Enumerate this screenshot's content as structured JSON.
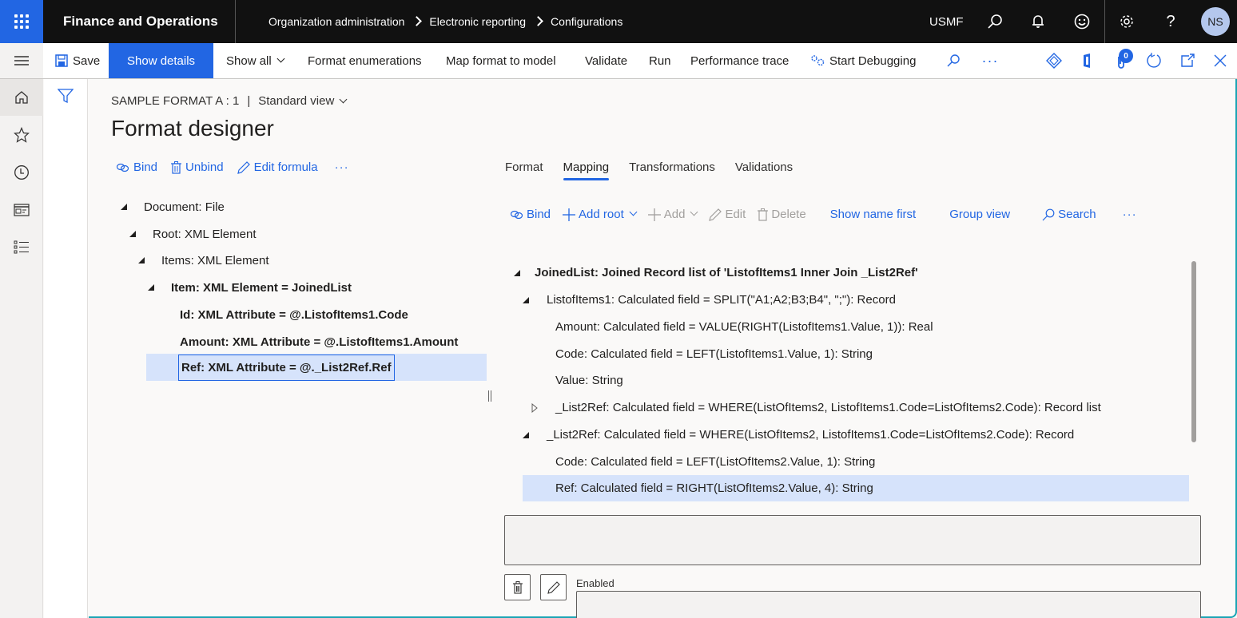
{
  "topbar": {
    "app_title": "Finance and Operations",
    "breadcrumb": [
      "Organization administration",
      "Electronic reporting",
      "Configurations"
    ],
    "company": "USMF",
    "avatar_initials": "NS",
    "icons": [
      "search-icon",
      "bell-icon",
      "smiley-icon",
      "settings-icon",
      "help-icon"
    ]
  },
  "actionbar": {
    "save": "Save",
    "show_details": "Show details",
    "show_all": "Show all",
    "format_enumerations": "Format enumerations",
    "map_format_to_model": "Map format to model",
    "validate": "Validate",
    "run": "Run",
    "performance_trace": "Performance trace",
    "start_debugging": "Start Debugging",
    "attachments_count": "0",
    "colors": {
      "accent": "#2266e3",
      "topbar": "#111111"
    }
  },
  "page": {
    "context": "SAMPLE FORMAT A : 1",
    "separator": "|",
    "view": "Standard view",
    "title": "Format designer"
  },
  "format_toolbar": {
    "bind": "Bind",
    "unbind": "Unbind",
    "edit_formula": "Edit formula",
    "more": "···"
  },
  "format_tree": [
    {
      "label": "Document: File",
      "expanded": true,
      "bold": false
    },
    {
      "label": "Root: XML Element",
      "expanded": true,
      "bold": false
    },
    {
      "label": "Items: XML Element",
      "expanded": true,
      "bold": false
    },
    {
      "label": "Item: XML Element = JoinedList",
      "expanded": true,
      "bold": true
    },
    {
      "label": "Id: XML Attribute = @.ListofItems1.Code",
      "bold": true
    },
    {
      "label": "Amount: XML Attribute = @.ListofItems1.Amount",
      "bold": true
    },
    {
      "label": "Ref: XML Attribute = @._List2Ref.Ref",
      "bold": true,
      "selected": true
    }
  ],
  "tabs": [
    {
      "label": "Format",
      "active": false
    },
    {
      "label": "Mapping",
      "active": true
    },
    {
      "label": "Transformations",
      "active": false
    },
    {
      "label": "Validations",
      "active": false
    }
  ],
  "mapping_toolbar": {
    "bind": "Bind",
    "add_root": "Add root",
    "add": "Add",
    "edit": "Edit",
    "delete": "Delete",
    "show_name_first": "Show name first",
    "group_view": "Group view",
    "search": "Search",
    "more": "···"
  },
  "mapping_tree": [
    {
      "label": "JoinedList: Joined Record list of 'ListofItems1 Inner Join _List2Ref'",
      "expanded": true,
      "bold": true
    },
    {
      "label": "ListofItems1: Calculated field = SPLIT(\"A1;A2;B3;B4\", \";\"): Record",
      "expanded": true
    },
    {
      "label": "Amount: Calculated field = VALUE(RIGHT(ListofItems1.Value, 1)): Real"
    },
    {
      "label": "Code: Calculated field = LEFT(ListofItems1.Value, 1): String"
    },
    {
      "label": "Value: String"
    },
    {
      "label": "_List2Ref: Calculated field = WHERE(ListOfItems2, ListofItems1.Code=ListOfItems2.Code): Record list",
      "expanded": false
    },
    {
      "label": "_List2Ref: Calculated field = WHERE(ListOfItems2, ListofItems1.Code=ListOfItems2.Code): Record",
      "expanded": true
    },
    {
      "label": "Code: Calculated field = LEFT(ListOfItems2.Value, 1): String"
    },
    {
      "label": "Ref: Calculated field = RIGHT(ListOfItems2.Value, 4): String",
      "selected": true
    }
  ],
  "details": {
    "formula_value": "",
    "enabled_label": "Enabled",
    "enabled_value": ""
  }
}
